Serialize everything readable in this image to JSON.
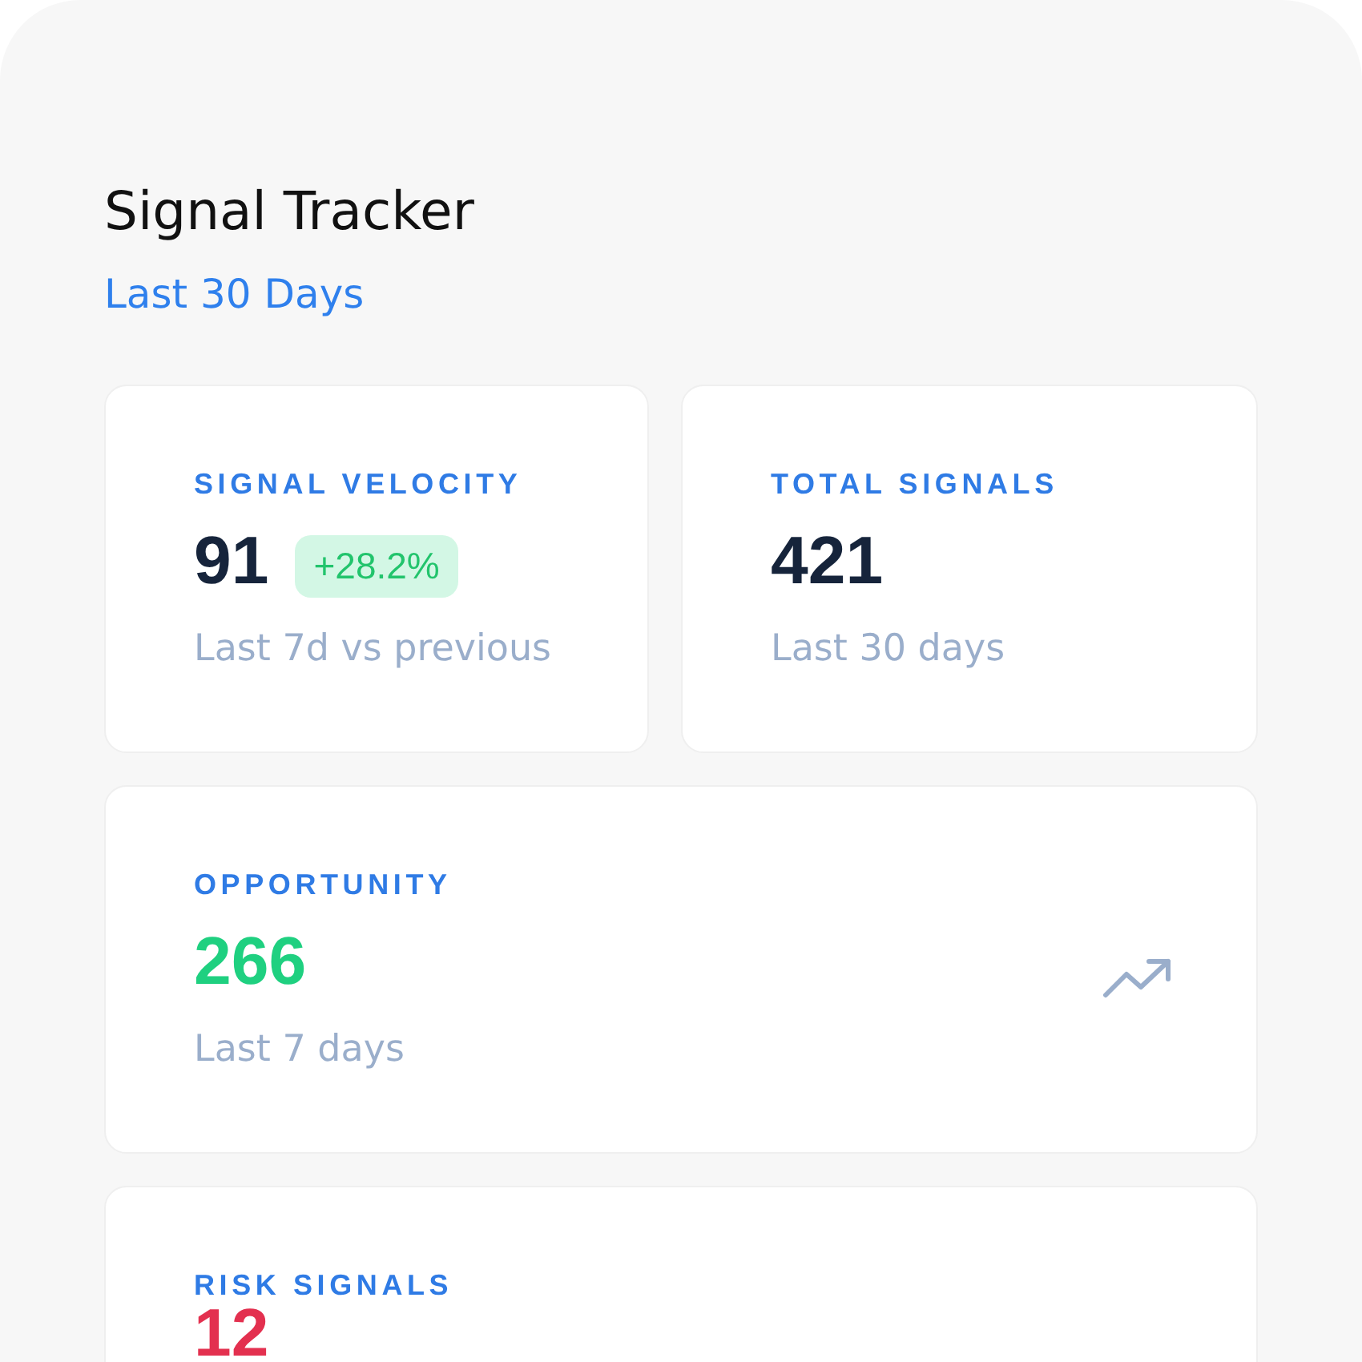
{
  "header": {
    "title": "Signal Tracker",
    "period": "Last 30 Days"
  },
  "metrics": [
    {
      "kind": "compact",
      "label": "SIGNAL VELOCITY",
      "value": "91",
      "color": "#16243b",
      "badge": "+28.2%",
      "caption": "Last 7d vs previous"
    },
    {
      "kind": "compact",
      "label": "TOTAL SIGNALS",
      "value": "421",
      "color": "#16243b",
      "caption": "Last 30 days"
    },
    {
      "kind": "trend",
      "label": "OPPORTUNITY",
      "value": "266",
      "color": "#1fd080",
      "caption": "Last 7 days"
    },
    {
      "kind": "plain",
      "label": "RISK SIGNALS",
      "value": "12",
      "color": "#e3304f"
    }
  ]
}
